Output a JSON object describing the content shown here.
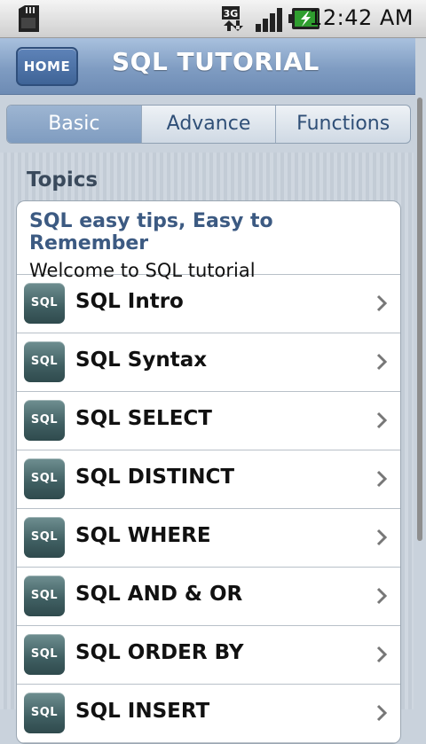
{
  "status_bar": {
    "time": "12:42 AM",
    "network_label": "3G"
  },
  "header": {
    "home_label": "HOME",
    "title": "SQL TUTORIAL"
  },
  "tabs": [
    {
      "label": "Basic",
      "active": true
    },
    {
      "label": "Advance",
      "active": false
    },
    {
      "label": "Functions",
      "active": false
    }
  ],
  "section": {
    "heading": "Topics"
  },
  "intro": {
    "title": "SQL easy tips, Easy to Remember",
    "subtitle": "Welcome to SQL tutorial"
  },
  "icon_text": "SQL",
  "items": [
    {
      "label": "SQL Intro"
    },
    {
      "label": "SQL Syntax"
    },
    {
      "label": "SQL SELECT"
    },
    {
      "label": "SQL DISTINCT"
    },
    {
      "label": "SQL WHERE"
    },
    {
      "label": "SQL AND & OR"
    },
    {
      "label": "SQL ORDER BY"
    },
    {
      "label": "SQL INSERT"
    }
  ],
  "colors": {
    "header": "#7f9cc2",
    "accent_text": "#3c5a82",
    "battery": "#2f9e2f"
  }
}
